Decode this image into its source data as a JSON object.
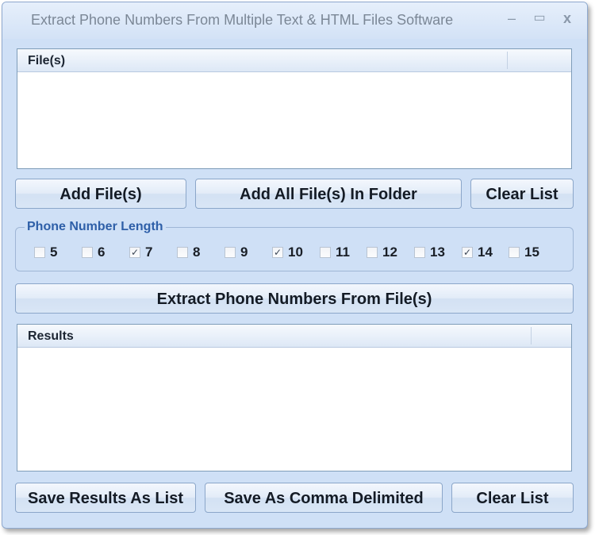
{
  "window": {
    "title": "Extract Phone Numbers From Multiple Text & HTML Files Software",
    "minimize_glyph": "–",
    "maximize_glyph": "▭",
    "close_glyph": "x"
  },
  "files_list": {
    "column_header": "File(s)",
    "rows": []
  },
  "file_buttons": {
    "add_files": "Add File(s)",
    "add_folder": "Add All File(s) In Folder",
    "clear_list": "Clear List"
  },
  "phone_length": {
    "group_label": "Phone Number Length",
    "options": [
      {
        "label": "5",
        "checked": false
      },
      {
        "label": "6",
        "checked": false
      },
      {
        "label": "7",
        "checked": true
      },
      {
        "label": "8",
        "checked": false
      },
      {
        "label": "9",
        "checked": false
      },
      {
        "label": "10",
        "checked": true
      },
      {
        "label": "11",
        "checked": false
      },
      {
        "label": "12",
        "checked": false
      },
      {
        "label": "13",
        "checked": false
      },
      {
        "label": "14",
        "checked": true
      },
      {
        "label": "15",
        "checked": false
      }
    ]
  },
  "extract_button": "Extract Phone Numbers From File(s)",
  "results_list": {
    "column_header": "Results",
    "rows": []
  },
  "result_buttons": {
    "save_list": "Save Results As List",
    "save_comma": "Save As Comma Delimited",
    "clear_list": "Clear List"
  }
}
